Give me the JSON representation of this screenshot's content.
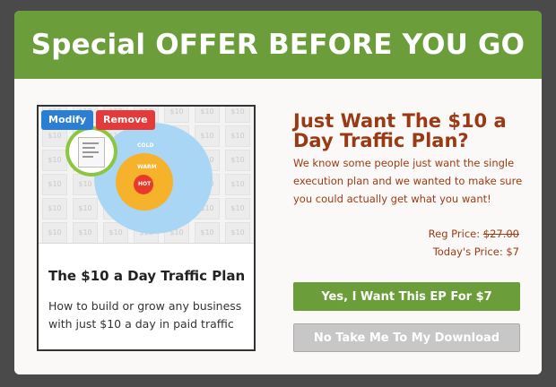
{
  "modal": {
    "title": "Special OFFER BEFORE YOU GO"
  },
  "product": {
    "thumbnail_tile_text": "$10",
    "ring_labels": {
      "cold": "COLD",
      "warm": "WARM",
      "hot": "HOT"
    },
    "modify_label": "Modify",
    "remove_label": "Remove",
    "title": "The $10 a Day Traffic Plan",
    "description": "How to build or grow any business with just $10 a day in paid traffic"
  },
  "offer": {
    "headline": "Just Want The $10 a Day Traffic Plan?",
    "pitch": "We know some people just want the single execution plan and we wanted to make sure you could actually get what you want!",
    "reg_price_label": "Reg Price: ",
    "reg_price_value": "$27.00",
    "today_price": "Today's Price: $7",
    "accept_label": "Yes, I Want This EP For $7",
    "decline_label": "No Take Me To My Download"
  },
  "colors": {
    "header_green": "#6b9e3a",
    "headline_brown": "#9a3a14",
    "modify_blue": "#2a7fd4",
    "remove_red": "#e53a3a",
    "decline_gray": "#c7c7c7"
  }
}
